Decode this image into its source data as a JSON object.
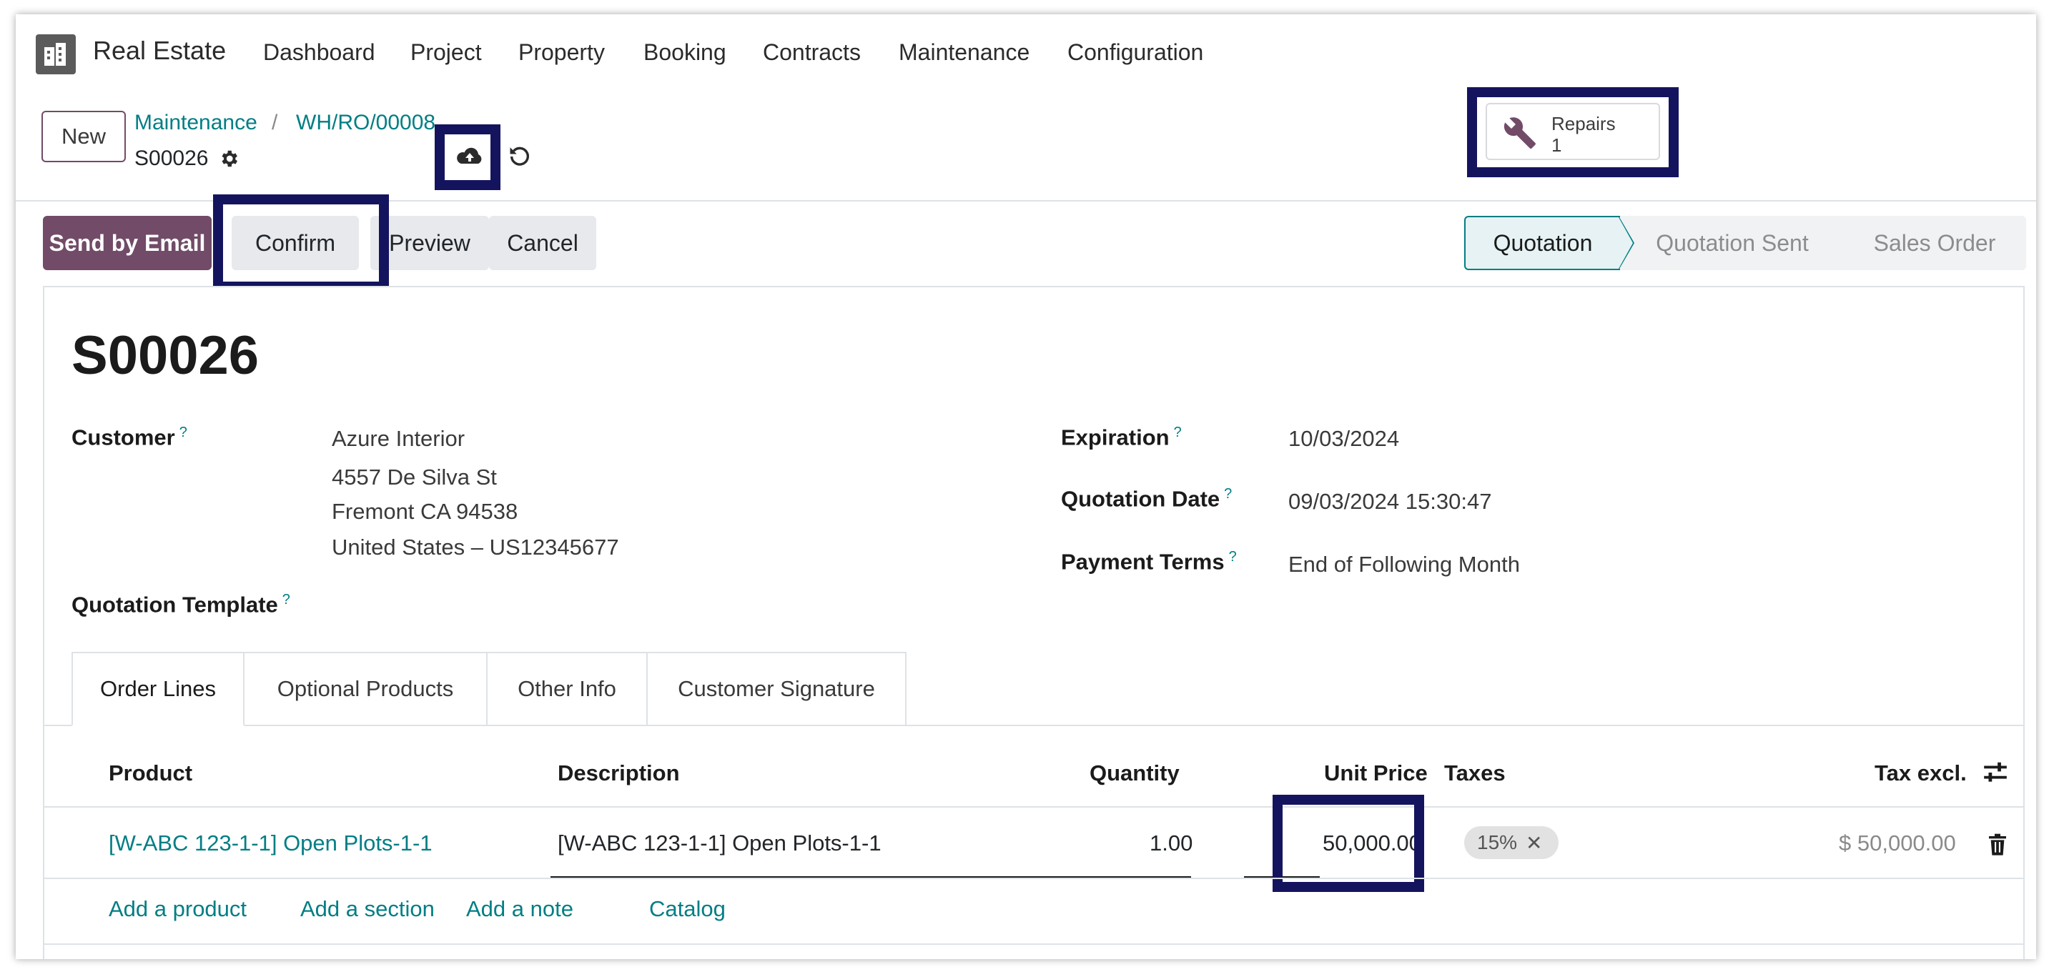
{
  "navbar": {
    "app_name": "Real Estate",
    "menu": [
      "Dashboard",
      "Project",
      "Property",
      "Booking",
      "Contracts",
      "Maintenance",
      "Configuration"
    ]
  },
  "control_panel": {
    "new_label": "New",
    "breadcrumb_root": "Maintenance",
    "breadcrumb_sep": "/",
    "breadcrumb_ref": "WH/RO/00008",
    "record_name": "S00026",
    "repairs_label": "Repairs",
    "repairs_count": "1"
  },
  "actions": {
    "send_by_email": "Send by Email",
    "confirm": "Confirm",
    "preview": "Preview",
    "cancel": "Cancel"
  },
  "status": {
    "stages": [
      "Quotation",
      "Quotation Sent",
      "Sales Order"
    ],
    "active": "Quotation"
  },
  "form": {
    "title": "S00026",
    "customer_label": "Customer",
    "customer_name": "Azure Interior",
    "customer_address_1": "4557 De Silva St",
    "customer_address_2": "Fremont CA 94538",
    "customer_address_3": "United States – US12345677",
    "template_label": "Quotation Template",
    "expiration_label": "Expiration",
    "expiration_value": "10/03/2024",
    "quotation_date_label": "Quotation Date",
    "quotation_date_value": "09/03/2024 15:30:47",
    "payment_terms_label": "Payment Terms",
    "payment_terms_value": "End of Following Month",
    "help_mark": "?"
  },
  "tabs": [
    "Order Lines",
    "Optional Products",
    "Other Info",
    "Customer Signature"
  ],
  "order_lines": {
    "columns": [
      "Product",
      "Description",
      "Quantity",
      "Unit Price",
      "Taxes",
      "Tax excl."
    ],
    "rows": [
      {
        "product": "[W-ABC 123-1-1] Open Plots-1-1",
        "description": "[W-ABC 123-1-1] Open Plots-1-1",
        "quantity": "1.00",
        "unit_price": "50,000.00",
        "tax": "15%",
        "subtotal": "$ 50,000.00"
      }
    ],
    "add_product": "Add a product",
    "add_section": "Add a section",
    "add_note": "Add a note",
    "catalog": "Catalog"
  },
  "colors": {
    "primary": "#714B67",
    "link": "#017e84",
    "highlight": "#14145e"
  },
  "icons": [
    "building-logo-icon",
    "gear-icon",
    "cloud-upload-icon",
    "undo-icon",
    "wrench-icon",
    "optional-columns-icon",
    "trash-icon",
    "remove-tag-icon"
  ]
}
